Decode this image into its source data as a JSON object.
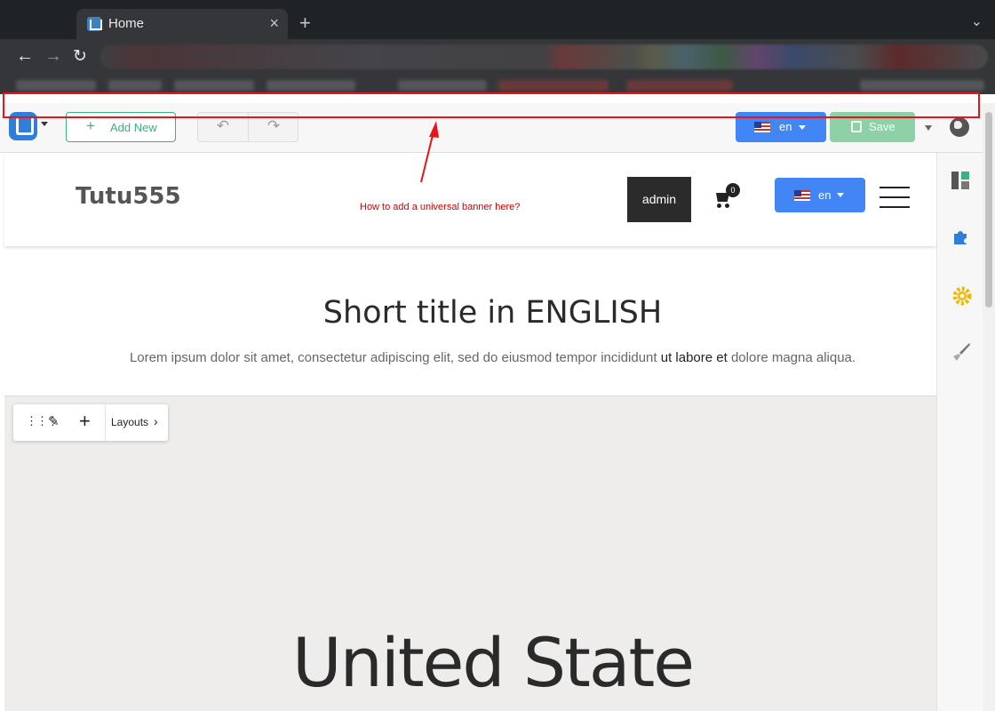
{
  "browser": {
    "tab_title": "Home",
    "new_tab": "+",
    "close": "×"
  },
  "editor_toolbar": {
    "add_new_label": "Add New",
    "language": "en",
    "save_label": "Save"
  },
  "site": {
    "brand": "Tutu555",
    "admin_label": "admin",
    "cart_count": "0",
    "language": "en"
  },
  "annotation": {
    "note": "How to add a universal banner here?"
  },
  "hero": {
    "title": "Short title in ENGLISH",
    "subtitle_a": "Lorem ipsum dolor sit amet, consectetur adipiscing elit, sed do eiusmod tempor incididunt ",
    "subtitle_b": "ut labore et",
    "subtitle_c": " dolore magna aliqua."
  },
  "section": {
    "layouts_label": "Layouts",
    "heading": "United State"
  },
  "colors": {
    "accent_blue": "#4285f4",
    "add_green": "#36b37e",
    "save_green": "#8ed1a7",
    "annotation_red": "#e8141b"
  }
}
